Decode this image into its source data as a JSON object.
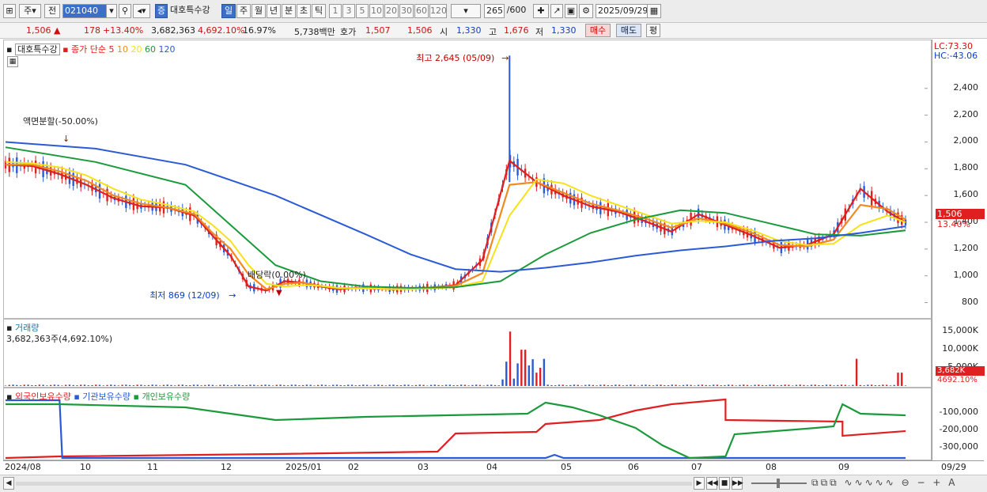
{
  "toolbar": {
    "market_label": "주",
    "prev_label": "전",
    "stock_code": "021040",
    "stock_name": "대호특수강",
    "badge": "증",
    "periods": [
      "일",
      "주",
      "월",
      "년",
      "분",
      "초",
      "틱"
    ],
    "intervals": [
      "1",
      "3",
      "5",
      "10",
      "20",
      "30",
      "60",
      "120"
    ],
    "count_value": "265",
    "count_total": "/600",
    "date_value": "2025/09/29"
  },
  "quote": {
    "price": "1,506",
    "change": "178",
    "change_pct": "+13.40%",
    "volume": "3,682,363",
    "volume_pct": "4,692.10%",
    "turnover": "16.97%",
    "amount": "5,738백만",
    "bid_label": "호가",
    "bid1": "1,507",
    "bid2": "1,506",
    "open_label": "시",
    "open": "1,330",
    "high_label": "고",
    "high": "1,676",
    "low_label": "저",
    "low": "1,330",
    "buy_label": "매수",
    "sell_label": "매도",
    "eval_label": "평"
  },
  "price_pane": {
    "legend_name": "대호특수강",
    "legend_ma": "종가 단순",
    "ma_periods": [
      "5",
      "10",
      "20",
      "60",
      "120"
    ],
    "ma_colors": [
      "#e02020",
      "#f08a20",
      "#f5e21a",
      "#1a9a3a",
      "#2a5ad6"
    ],
    "lc": "LC:73.30",
    "hc": "HC:-43.06",
    "last_price_tag": "1,506",
    "last_pct_tag": "13.40%",
    "annotations": {
      "high": "최고 2,645 (05/09)",
      "low": "최저 869 (12/09)",
      "split": "액면분할(-50.00%)",
      "dividend": "배당락(0.00%)"
    },
    "y_ticks": [
      "2,400",
      "2,200",
      "2,000",
      "1,800",
      "1,600",
      "1,400",
      "1,200",
      "1,000",
      "800"
    ]
  },
  "volume_pane": {
    "title": "거래량",
    "value": "3,682,363주(4,692.10%)",
    "y_ticks": [
      "15,000K",
      "10,000K",
      "5,000K"
    ],
    "last_tag": "3,682K",
    "pct_tag": "4692.10%"
  },
  "holding_pane": {
    "legend": [
      "외국인보유수량",
      "기관보유수량",
      "개인보유수량"
    ],
    "y_ticks": [
      "-100,000",
      "-200,000",
      "-300,000"
    ]
  },
  "x_ticks": [
    "2024/08",
    "10",
    "11",
    "12",
    "2025/01",
    "02",
    "03",
    "04",
    "05",
    "06",
    "07",
    "08",
    "09",
    "09/29"
  ],
  "chart_data": {
    "type": "line",
    "title": "대호특수강",
    "x_ticks": [
      "2024/08",
      "10",
      "11",
      "12",
      "2025/01",
      "02",
      "03",
      "04",
      "05",
      "06",
      "07",
      "08",
      "09"
    ],
    "price_ylim": [
      750,
      2700
    ],
    "series": [
      {
        "name": "5",
        "x": [
          0,
          3,
          6,
          9,
          12,
          15,
          18,
          21,
          23,
          25,
          27,
          29,
          31,
          33,
          35,
          37,
          39,
          41,
          43,
          45,
          47,
          50,
          53,
          56,
          59,
          62,
          65,
          68,
          71,
          74,
          77,
          80,
          83,
          86,
          89,
          92,
          95,
          98,
          100
        ],
        "values": [
          1830,
          1820,
          1760,
          1680,
          1580,
          1520,
          1510,
          1450,
          1300,
          1150,
          920,
          890,
          960,
          950,
          920,
          900,
          910,
          905,
          900,
          905,
          910,
          930,
          1120,
          1860,
          1700,
          1600,
          1520,
          1480,
          1410,
          1330,
          1460,
          1380,
          1300,
          1210,
          1230,
          1310,
          1650,
          1480,
          1400
        ]
      },
      {
        "name": "10",
        "x": [
          0,
          3,
          6,
          9,
          12,
          15,
          18,
          21,
          23,
          25,
          27,
          29,
          31,
          33,
          35,
          37,
          39,
          41,
          43,
          45,
          47,
          50,
          53,
          56,
          59,
          62,
          65,
          68,
          71,
          74,
          77,
          80,
          83,
          86,
          89,
          92,
          95,
          98,
          100
        ],
        "values": [
          1830,
          1830,
          1780,
          1710,
          1600,
          1540,
          1510,
          1460,
          1320,
          1200,
          1010,
          900,
          940,
          950,
          925,
          905,
          910,
          905,
          900,
          905,
          910,
          925,
          1020,
          1680,
          1700,
          1620,
          1540,
          1490,
          1430,
          1360,
          1430,
          1390,
          1320,
          1230,
          1220,
          1270,
          1530,
          1500,
          1420
        ]
      },
      {
        "name": "20",
        "x": [
          0,
          3,
          6,
          9,
          12,
          15,
          18,
          21,
          23,
          25,
          27,
          29,
          31,
          33,
          35,
          37,
          39,
          41,
          43,
          45,
          47,
          50,
          53,
          56,
          59,
          62,
          65,
          68,
          71,
          74,
          77,
          80,
          83,
          86,
          89,
          92,
          95,
          98,
          100
        ],
        "values": [
          1850,
          1840,
          1810,
          1750,
          1650,
          1570,
          1530,
          1480,
          1380,
          1260,
          1080,
          940,
          920,
          930,
          925,
          910,
          905,
          905,
          900,
          900,
          905,
          915,
          960,
          1450,
          1720,
          1690,
          1600,
          1530,
          1460,
          1390,
          1410,
          1400,
          1340,
          1260,
          1230,
          1240,
          1380,
          1450,
          1400
        ]
      },
      {
        "name": "60",
        "x": [
          0,
          10,
          20,
          30,
          35,
          40,
          45,
          50,
          55,
          60,
          65,
          70,
          75,
          80,
          85,
          90,
          95,
          100
        ],
        "values": [
          1960,
          1850,
          1680,
          1080,
          960,
          920,
          910,
          915,
          960,
          1160,
          1320,
          1420,
          1490,
          1470,
          1390,
          1310,
          1300,
          1340
        ]
      },
      {
        "name": "120",
        "x": [
          0,
          10,
          20,
          30,
          40,
          45,
          50,
          55,
          60,
          65,
          70,
          75,
          80,
          85,
          90,
          95,
          100
        ],
        "values": [
          2000,
          1950,
          1830,
          1600,
          1310,
          1160,
          1050,
          1030,
          1060,
          1100,
          1150,
          1190,
          1220,
          1260,
          1280,
          1320,
          1370
        ]
      }
    ],
    "highest": {
      "label": "최고",
      "value": 2645,
      "date": "05/09"
    },
    "lowest": {
      "label": "최저",
      "value": 869,
      "date": "12/09"
    }
  }
}
